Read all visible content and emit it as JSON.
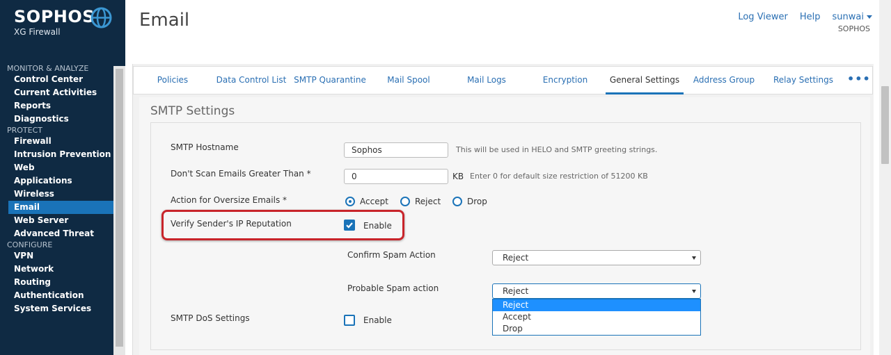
{
  "brand": {
    "name": "SOPHOS",
    "product": "XG Firewall"
  },
  "header": {
    "title": "Email",
    "links": [
      "Log Viewer",
      "Help",
      "sunwai"
    ],
    "org": "SOPHOS"
  },
  "sidebar": {
    "sections": [
      {
        "title": "MONITOR & ANALYZE",
        "items": [
          "Control Center",
          "Current Activities",
          "Reports",
          "Diagnostics"
        ]
      },
      {
        "title": "PROTECT",
        "items": [
          "Firewall",
          "Intrusion Prevention",
          "Web",
          "Applications",
          "Wireless",
          "Email",
          "Web Server",
          "Advanced Threat"
        ]
      },
      {
        "title": "CONFIGURE",
        "items": [
          "VPN",
          "Network",
          "Routing",
          "Authentication",
          "System Services"
        ]
      }
    ],
    "active": "Email"
  },
  "tabs": [
    "Policies",
    "Data Control List",
    "SMTP Quarantine",
    "Mail Spool",
    "Mail Logs",
    "Encryption",
    "General Settings",
    "Address Group",
    "Relay Settings"
  ],
  "active_tab": "General Settings",
  "more_label": "•••",
  "smtp": {
    "section_title": "SMTP Settings",
    "hostname_label": "SMTP Hostname",
    "hostname_value": "Sophos",
    "hostname_hint": "This will be used in HELO and SMTP greeting strings.",
    "maxsize_label": "Don't Scan Emails Greater Than *",
    "maxsize_value": "0",
    "maxsize_unit": "KB",
    "maxsize_hint": "Enter 0 for default size restriction of 51200 KB",
    "oversize_label": "Action for Oversize Emails *",
    "oversize_options": [
      "Accept",
      "Reject",
      "Drop"
    ],
    "oversize_selected": "Accept",
    "reputation_label": "Verify Sender's IP Reputation",
    "reputation_check_label": "Enable",
    "reputation_checked": true,
    "confirm_label": "Confirm Spam Action",
    "confirm_value": "Reject",
    "probable_label": "Probable Spam action",
    "probable_value": "Reject",
    "probable_options": [
      "Reject",
      "Accept",
      "Drop"
    ],
    "dos_label": "SMTP DoS Settings",
    "dos_check_label": "Enable",
    "dos_checked": false
  },
  "colors": {
    "sidebar": "#0f2a43",
    "accent": "#1a73b8",
    "highlight": "#c8242a"
  }
}
